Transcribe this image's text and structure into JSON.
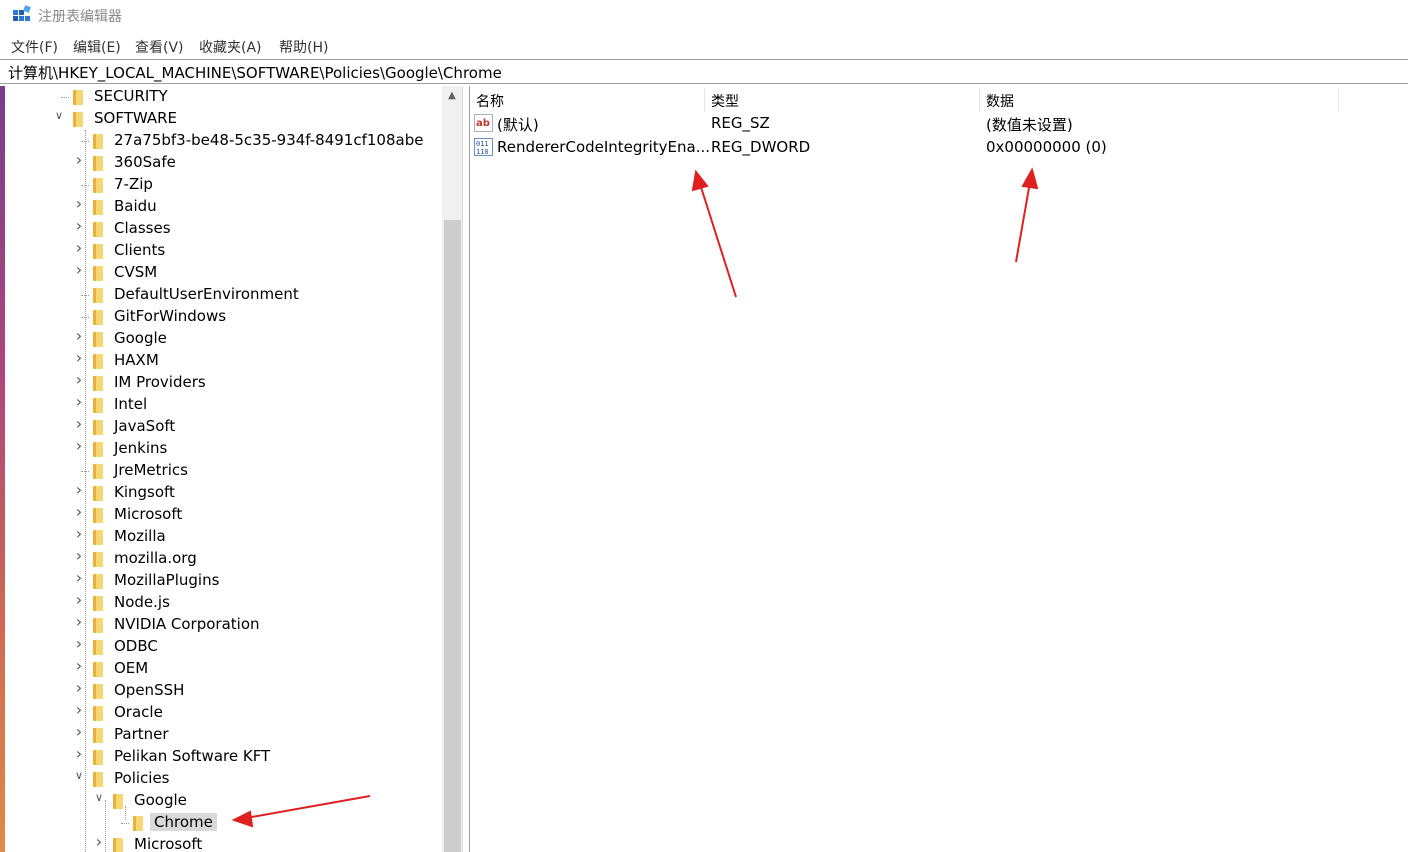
{
  "window": {
    "title": "注册表编辑器"
  },
  "menu": [
    "文件(F)",
    "编辑(E)",
    "查看(V)",
    "收藏夹(A)",
    "帮助(H)"
  ],
  "address": "计算机\\HKEY_LOCAL_MACHINE\\SOFTWARE\\Policies\\Google\\Chrome",
  "tree": {
    "items": [
      {
        "label": "SECURITY",
        "level": 1,
        "state": "leaf"
      },
      {
        "label": "SOFTWARE",
        "level": 1,
        "state": "expanded"
      },
      {
        "label": "27a75bf3-be48-5c35-934f-8491cf108abe",
        "level": 2,
        "state": "leaf"
      },
      {
        "label": "360Safe",
        "level": 2,
        "state": "collapsed"
      },
      {
        "label": "7-Zip",
        "level": 2,
        "state": "leaf"
      },
      {
        "label": "Baidu",
        "level": 2,
        "state": "collapsed"
      },
      {
        "label": "Classes",
        "level": 2,
        "state": "collapsed"
      },
      {
        "label": "Clients",
        "level": 2,
        "state": "collapsed"
      },
      {
        "label": "CVSM",
        "level": 2,
        "state": "collapsed"
      },
      {
        "label": "DefaultUserEnvironment",
        "level": 2,
        "state": "leaf"
      },
      {
        "label": "GitForWindows",
        "level": 2,
        "state": "leaf"
      },
      {
        "label": "Google",
        "level": 2,
        "state": "collapsed"
      },
      {
        "label": "HAXM",
        "level": 2,
        "state": "collapsed"
      },
      {
        "label": "IM Providers",
        "level": 2,
        "state": "collapsed"
      },
      {
        "label": "Intel",
        "level": 2,
        "state": "collapsed"
      },
      {
        "label": "JavaSoft",
        "level": 2,
        "state": "collapsed"
      },
      {
        "label": "Jenkins",
        "level": 2,
        "state": "collapsed"
      },
      {
        "label": "JreMetrics",
        "level": 2,
        "state": "leaf"
      },
      {
        "label": "Kingsoft",
        "level": 2,
        "state": "collapsed"
      },
      {
        "label": "Microsoft",
        "level": 2,
        "state": "collapsed"
      },
      {
        "label": "Mozilla",
        "level": 2,
        "state": "collapsed"
      },
      {
        "label": "mozilla.org",
        "level": 2,
        "state": "collapsed"
      },
      {
        "label": "MozillaPlugins",
        "level": 2,
        "state": "collapsed"
      },
      {
        "label": "Node.js",
        "level": 2,
        "state": "collapsed"
      },
      {
        "label": "NVIDIA Corporation",
        "level": 2,
        "state": "collapsed"
      },
      {
        "label": "ODBC",
        "level": 2,
        "state": "collapsed"
      },
      {
        "label": "OEM",
        "level": 2,
        "state": "collapsed"
      },
      {
        "label": "OpenSSH",
        "level": 2,
        "state": "collapsed"
      },
      {
        "label": "Oracle",
        "level": 2,
        "state": "collapsed"
      },
      {
        "label": "Partner",
        "level": 2,
        "state": "collapsed"
      },
      {
        "label": "Pelikan Software KFT",
        "level": 2,
        "state": "collapsed"
      },
      {
        "label": "Policies",
        "level": 2,
        "state": "expanded"
      },
      {
        "label": "Google",
        "level": 3,
        "state": "expanded"
      },
      {
        "label": "Chrome",
        "level": 4,
        "state": "selected"
      },
      {
        "label": "Microsoft",
        "level": 3,
        "state": "collapsed"
      }
    ]
  },
  "columns": [
    "名称",
    "类型",
    "数据"
  ],
  "values": [
    {
      "icon": "string-value-icon",
      "name": "(默认)",
      "type": "REG_SZ",
      "data": "(数值未设置)"
    },
    {
      "icon": "binary-value-icon",
      "name": "RendererCodeIntegrityEna...",
      "type": "REG_DWORD",
      "data": "0x00000000 (0)"
    }
  ],
  "colors": {
    "annotation_arrow": "#e02020",
    "selection": "#d9d9d9",
    "folder": "#f7d774"
  }
}
